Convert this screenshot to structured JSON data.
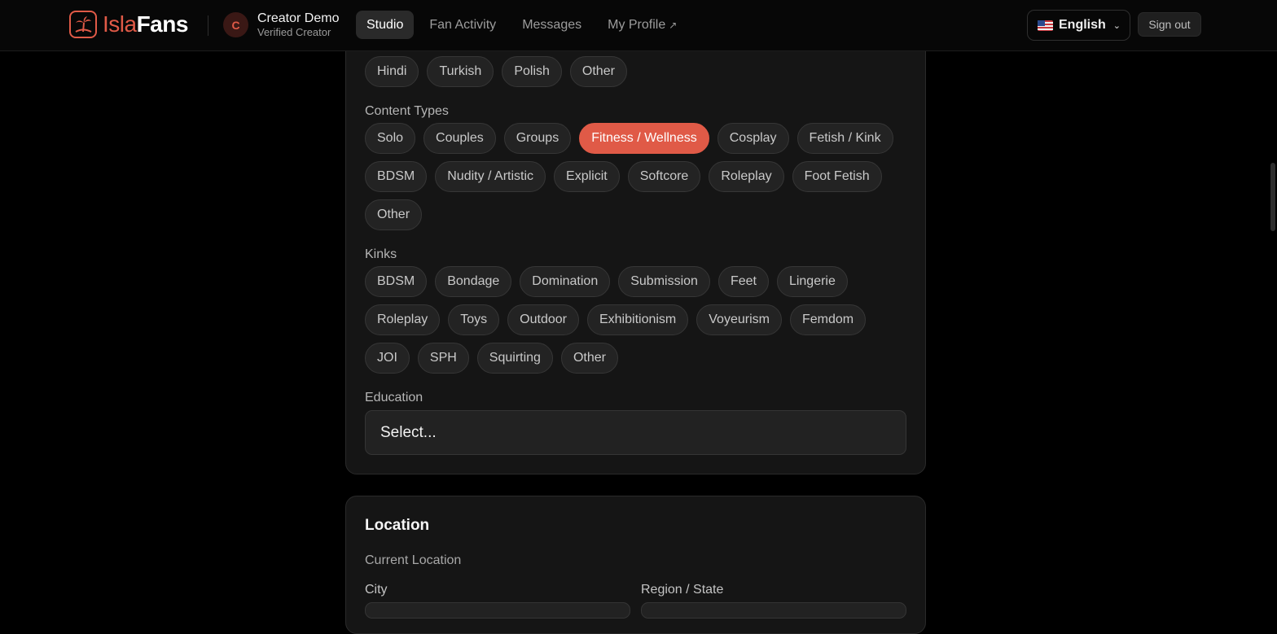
{
  "header": {
    "brand_part1": "Isla",
    "brand_part2": "Fans",
    "avatar_initial": "C",
    "creator_name": "Creator Demo",
    "creator_status": "Verified Creator",
    "nav": [
      "Studio",
      "Fan Activity",
      "Messages",
      "My Profile"
    ],
    "nav_active": "Studio",
    "external_arrow": "↗",
    "language": "English",
    "sign_out": "Sign out"
  },
  "languages_row": [
    "Hindi",
    "Turkish",
    "Polish",
    "Other"
  ],
  "content_types": {
    "label": "Content Types",
    "rows": [
      [
        "Solo",
        "Couples",
        "Groups",
        "Fitness / Wellness",
        "Cosplay",
        "Fetish / Kink"
      ],
      [
        "BDSM",
        "Nudity / Artistic",
        "Explicit",
        "Softcore",
        "Roleplay",
        "Foot Fetish"
      ],
      [
        "Other"
      ]
    ],
    "selected": "Fitness / Wellness"
  },
  "kinks": {
    "label": "Kinks",
    "rows": [
      [
        "BDSM",
        "Bondage",
        "Domination",
        "Submission",
        "Feet",
        "Lingerie"
      ],
      [
        "Roleplay",
        "Toys",
        "Outdoor",
        "Exhibitionism",
        "Voyeurism",
        "Femdom"
      ],
      [
        "JOI",
        "SPH",
        "Squirting",
        "Other"
      ]
    ]
  },
  "education": {
    "label": "Education",
    "value": "Select..."
  },
  "location": {
    "title": "Location",
    "current_label": "Current Location",
    "city_label": "City",
    "region_label": "Region / State"
  },
  "colors": {
    "accent": "#e05a47",
    "background": "#000000",
    "card": "#151515"
  }
}
